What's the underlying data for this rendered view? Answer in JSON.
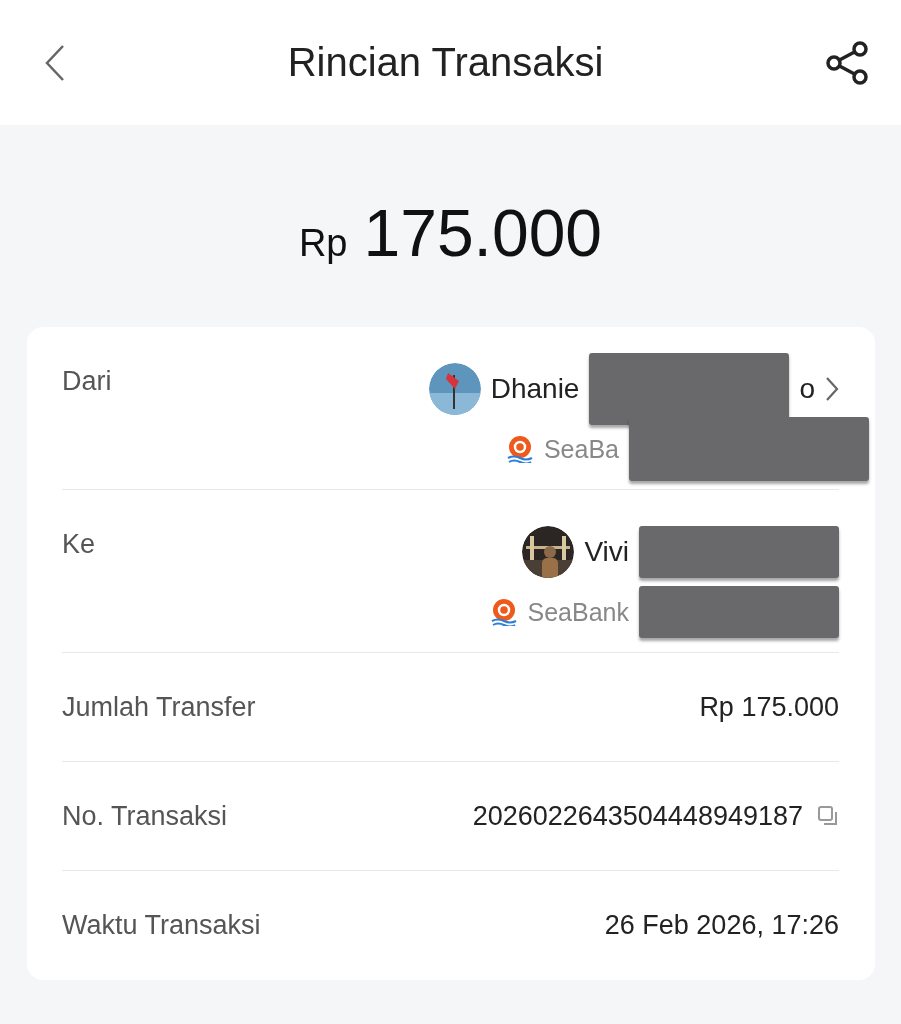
{
  "header": {
    "title": "Rincian Transaksi"
  },
  "amount": {
    "currency": "Rp",
    "value": "175.000"
  },
  "parties": [
    {
      "label": "Dari",
      "name": "Dhanie",
      "name_tail": "o",
      "bank": "SeaBa",
      "redacted": true,
      "chevron": true
    },
    {
      "label": "Ke",
      "name": "Vivi",
      "bank": "SeaBank",
      "redacted": true,
      "chevron": false
    }
  ],
  "details": [
    {
      "label": "Jumlah Transfer",
      "value": "Rp 175.000",
      "copyable": false
    },
    {
      "label": "No. Transaksi",
      "value": "2026022643504448949187",
      "copyable": true
    },
    {
      "label": "Waktu Transaksi",
      "value": "26 Feb 2026, 17:26",
      "copyable": false
    }
  ]
}
